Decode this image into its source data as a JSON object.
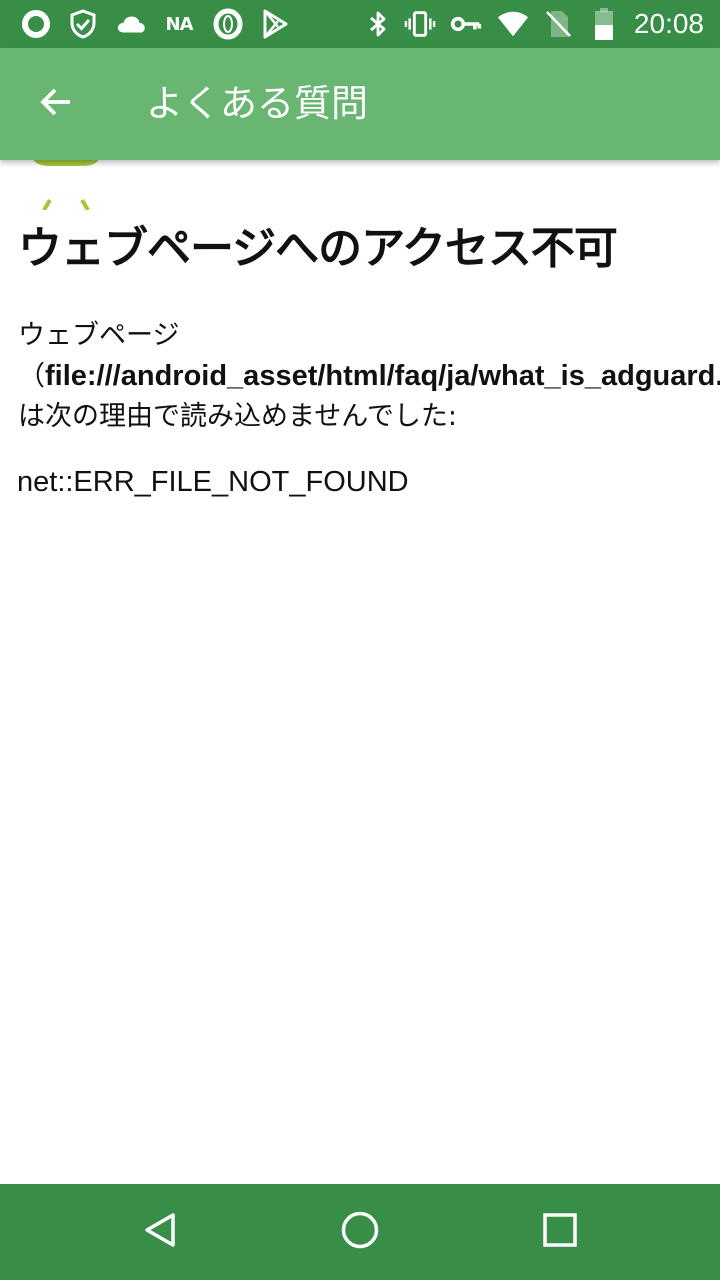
{
  "status_bar": {
    "time": "20:08",
    "background_color": "#388E47",
    "left_icons": [
      "ring-icon",
      "shield-check-icon",
      "cloud-icon",
      "na-text",
      "opera-icon",
      "play-store-icon"
    ],
    "na_label": "NA",
    "right_icons": [
      "bluetooth-icon",
      "vibrate-icon",
      "vpn-key-icon",
      "wifi-icon",
      "no-sim-icon",
      "battery-icon"
    ]
  },
  "app_bar": {
    "title": "よくある質問",
    "background_color": "#68B672",
    "back_icon": "arrow-back-icon"
  },
  "page": {
    "error_title": "ウェブページへのアクセス不可",
    "body_prefix": "ウェブページ",
    "open_paren": "（",
    "url": "file:///android_asset/html/faq/ja/what_is_adguard.html",
    "body_suffix": "は次の理由で読み込めませんでした:",
    "error_code": "net::ERR_FILE_NOT_FOUND",
    "logo_icon": "android-robot-icon",
    "logo_color": "#A4C639"
  },
  "nav_bar": {
    "background_color": "#388E47",
    "buttons": [
      "back-triangle-icon",
      "home-circle-icon",
      "recents-square-icon"
    ]
  }
}
